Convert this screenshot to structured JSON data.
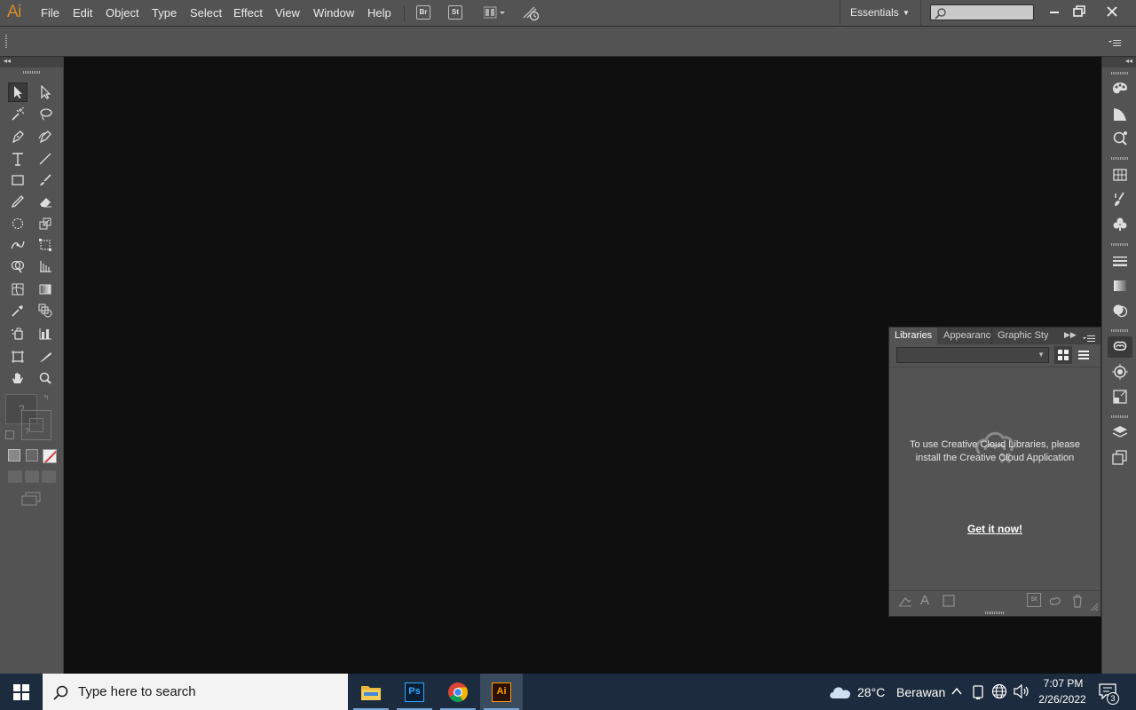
{
  "app": {
    "logo": "Ai"
  },
  "menu": {
    "items": [
      "File",
      "Edit",
      "Object",
      "Type",
      "Select",
      "Effect",
      "View",
      "Window",
      "Help"
    ],
    "bridge_label": "Br",
    "stock_label": "St"
  },
  "workspace": {
    "label": "Essentials"
  },
  "tools": {
    "fill_stroke_unknown": "?",
    "swatch_none_color": "#d83b3b"
  },
  "libraries_panel": {
    "tabs": [
      "Libraries",
      "Appearance",
      "Graphic Sty"
    ],
    "message": "To use Creative Cloud Libraries, please install the Creative Cloud Application",
    "link": "Get it now!",
    "footer_stock": "St"
  },
  "taskbar": {
    "search_placeholder": "Type here to search",
    "apps": [
      "file-explorer",
      "photoshop",
      "chrome",
      "illustrator"
    ],
    "ps_label": "Ps",
    "ai_label": "Ai",
    "weather_temp": "28°C",
    "weather_text": "Berawan",
    "time": "7:07 PM",
    "date": "2/26/2022",
    "notification_count": "3"
  },
  "colors": {
    "ui_gray": "#535353",
    "canvas": "#0f0f0f",
    "ai_orange": "#d68a2a",
    "taskbar": "#1c2b3d"
  }
}
